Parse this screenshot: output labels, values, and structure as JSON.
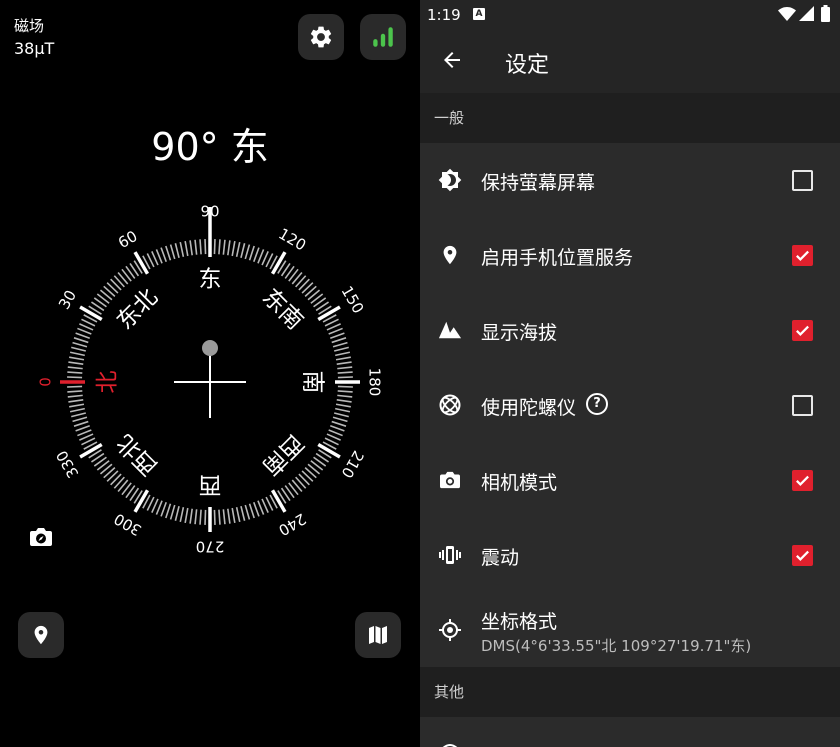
{
  "compass": {
    "magnetic_label": "磁场",
    "magnetic_value": "38μT",
    "heading_text": "90° 东",
    "degree_labels": [
      {
        "text": "0",
        "deg": 0,
        "red": true
      },
      {
        "text": "30",
        "deg": 30
      },
      {
        "text": "60",
        "deg": 60
      },
      {
        "text": "90",
        "deg": 90
      },
      {
        "text": "120",
        "deg": 120
      },
      {
        "text": "150",
        "deg": 150
      },
      {
        "text": "180",
        "deg": 180
      },
      {
        "text": "210",
        "deg": 210
      },
      {
        "text": "240",
        "deg": 240
      },
      {
        "text": "270",
        "deg": 270
      },
      {
        "text": "300",
        "deg": 300
      },
      {
        "text": "330",
        "deg": 330
      }
    ],
    "direction_labels": [
      {
        "text": "北",
        "deg": 0,
        "red": true
      },
      {
        "text": "东北",
        "deg": 45
      },
      {
        "text": "东",
        "deg": 90
      },
      {
        "text": "东南",
        "deg": 135
      },
      {
        "text": "南",
        "deg": 180
      },
      {
        "text": "西南",
        "deg": 225
      },
      {
        "text": "西",
        "deg": 270
      },
      {
        "text": "西北",
        "deg": 315
      }
    ],
    "accent_red": "#e0202d",
    "icons": [
      "gear-icon",
      "signal-bars-icon",
      "camera-compass-icon",
      "location-pin-icon",
      "map-icon"
    ]
  },
  "status": {
    "time": "1:19",
    "badge": "A"
  },
  "settings": {
    "title": "设定",
    "section_general": "一般",
    "section_other": "其他",
    "items": [
      {
        "label": "保持萤幕屏幕",
        "checked": false,
        "icon": "brightness-icon"
      },
      {
        "label": "启用手机位置服务",
        "checked": true,
        "icon": "location-pin-icon"
      },
      {
        "label": "显示海拔",
        "checked": true,
        "icon": "mountain-icon"
      },
      {
        "label": "使用陀螺仪",
        "checked": false,
        "icon": "gyroscope-icon"
      },
      {
        "label": "相机模式",
        "checked": true,
        "icon": "camera-icon"
      },
      {
        "label": "震动",
        "checked": true,
        "icon": "vibration-icon"
      }
    ],
    "coord_label": "坐标格式",
    "coord_value": "DMS(4°6'33.55\"北 109°27'19.71\"东)"
  }
}
